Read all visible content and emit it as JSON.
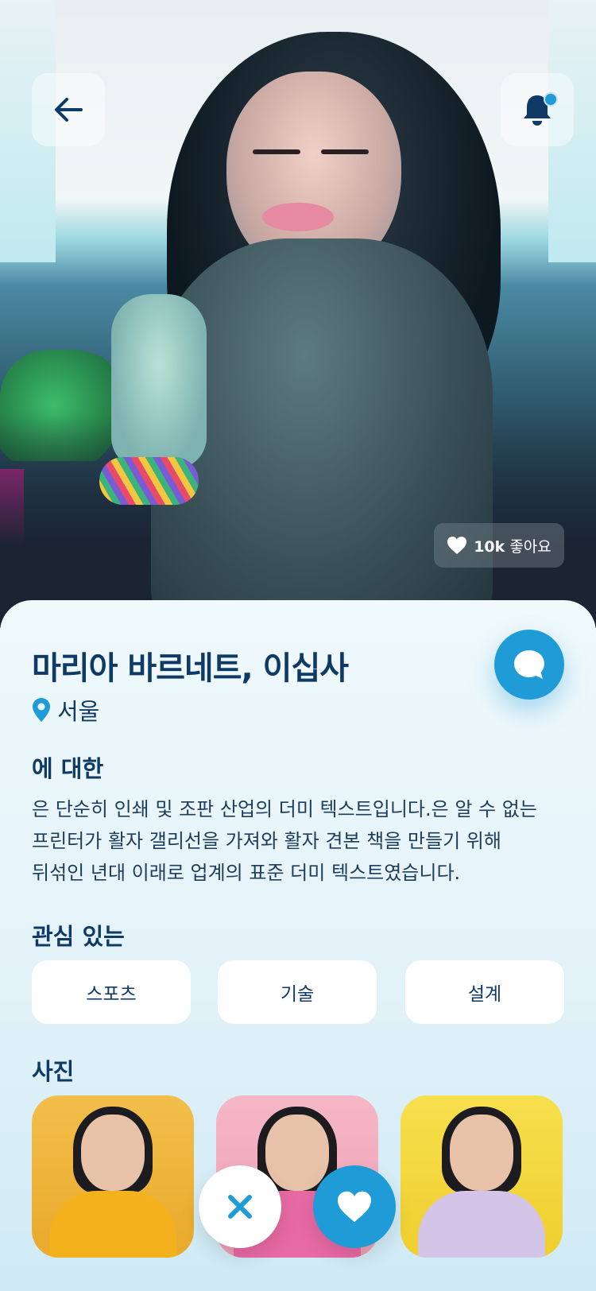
{
  "profile": {
    "name_age": "마리아 바르네트, 이십사",
    "location": "서울",
    "likes_count": "10k",
    "likes_label": "좋아요"
  },
  "about": {
    "title": "에 대한",
    "text_lines": [
      "은 단순히 인쇄 및 조판 산업의 더미 텍스트입니다.은 알 수 없는",
      "프린터가 활자 갤리선을 가져와 활자 견본 책을 만들기 위해",
      "뒤섞인 년대 이래로 업계의 표준 더미 텍스트였습니다."
    ]
  },
  "interests": {
    "title": "관심 있는",
    "items": [
      "스포츠",
      "기술",
      "설계"
    ]
  },
  "photos": {
    "title": "사진"
  },
  "icons": {
    "back": "arrow-left-icon",
    "notification": "bell-icon",
    "chat": "chat-bubble-icon",
    "location": "map-pin-icon",
    "like": "heart-icon",
    "dislike": "close-icon"
  },
  "colors": {
    "primary": "#1f9bd7",
    "text_dark": "#0f3a66",
    "background": "#e4f3f9"
  }
}
